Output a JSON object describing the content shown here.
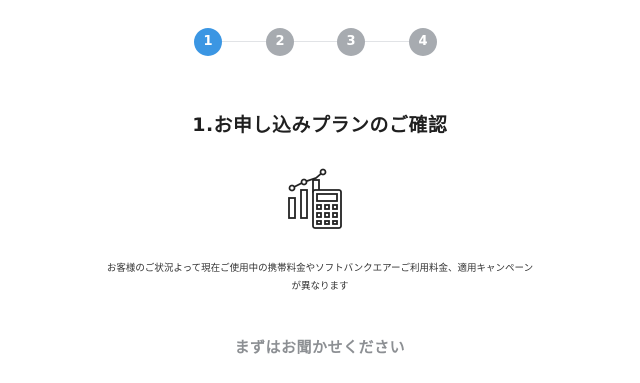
{
  "stepper": {
    "steps": [
      {
        "label": "1",
        "active": true
      },
      {
        "label": "2",
        "active": false
      },
      {
        "label": "3",
        "active": false
      },
      {
        "label": "4",
        "active": false
      }
    ],
    "colors": {
      "active": "#3b96e3",
      "inactive": "#a7abb0"
    }
  },
  "main": {
    "title": "1.お申し込みプランのご確認",
    "icon": "calculator-chart-icon",
    "description_line1": "お客様のご状況よって現在ご使用中の携帯料金やソフトバンクエアーご利用料金、適用キャンペーン",
    "description_line2": "が異なります",
    "lead": "まずはお聞かせください"
  }
}
